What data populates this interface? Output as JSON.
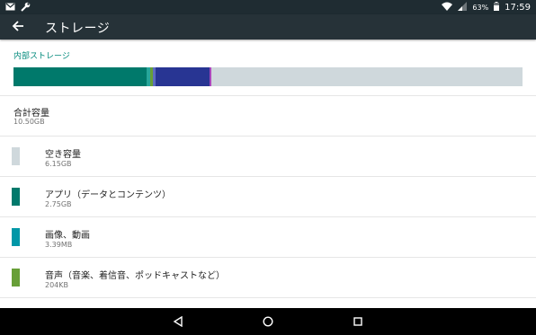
{
  "status_bar": {
    "battery_percent": "63%",
    "time": "17:59",
    "icons": [
      "mail-icon",
      "wrench-icon",
      "wifi-icon",
      "cell-signal-icon",
      "battery-icon"
    ]
  },
  "app_bar": {
    "title": "ストレージ",
    "back_icon": "arrow-back-icon"
  },
  "storage": {
    "section_header": "内部ストレージ",
    "total_label": "合計容量",
    "total_value": "10.50GB",
    "usage_bar_colors": {
      "apps": "#00796b",
      "free": "#cfd8dc"
    },
    "items": [
      {
        "label": "空き容量",
        "value": "6.15GB",
        "color": "#cfd8dc"
      },
      {
        "label": "アプリ（データとコンテンツ）",
        "value": "2.75GB",
        "color": "#00796b"
      },
      {
        "label": "画像、動画",
        "value": "3.39MB",
        "color": "#0097a7"
      },
      {
        "label": "音声（音楽、着信音、ポッドキャストなど）",
        "value": "204KB",
        "color": "#689f38"
      }
    ]
  },
  "nav_bar": {
    "icons": [
      "back-triangle-icon",
      "home-circle-icon",
      "recents-square-icon"
    ]
  }
}
